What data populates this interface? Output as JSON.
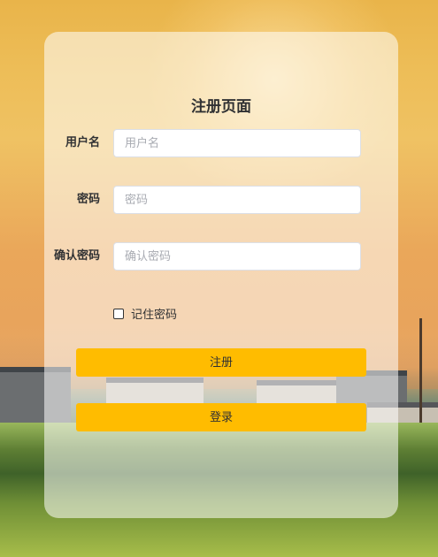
{
  "page": {
    "title": "注册页面"
  },
  "form": {
    "username": {
      "label": "用户名",
      "placeholder": "用户名",
      "value": ""
    },
    "password": {
      "label": "密码",
      "placeholder": "密码",
      "value": ""
    },
    "confirm_password": {
      "label": "确认密码",
      "placeholder": "确认密码",
      "value": ""
    },
    "remember": {
      "label": "记住密码",
      "checked": false
    }
  },
  "buttons": {
    "register_label": "注册",
    "login_label": "登录"
  },
  "colors": {
    "button": "#ffbc00",
    "card": "rgba(255,255,255,0.55)",
    "text": "#303133"
  }
}
